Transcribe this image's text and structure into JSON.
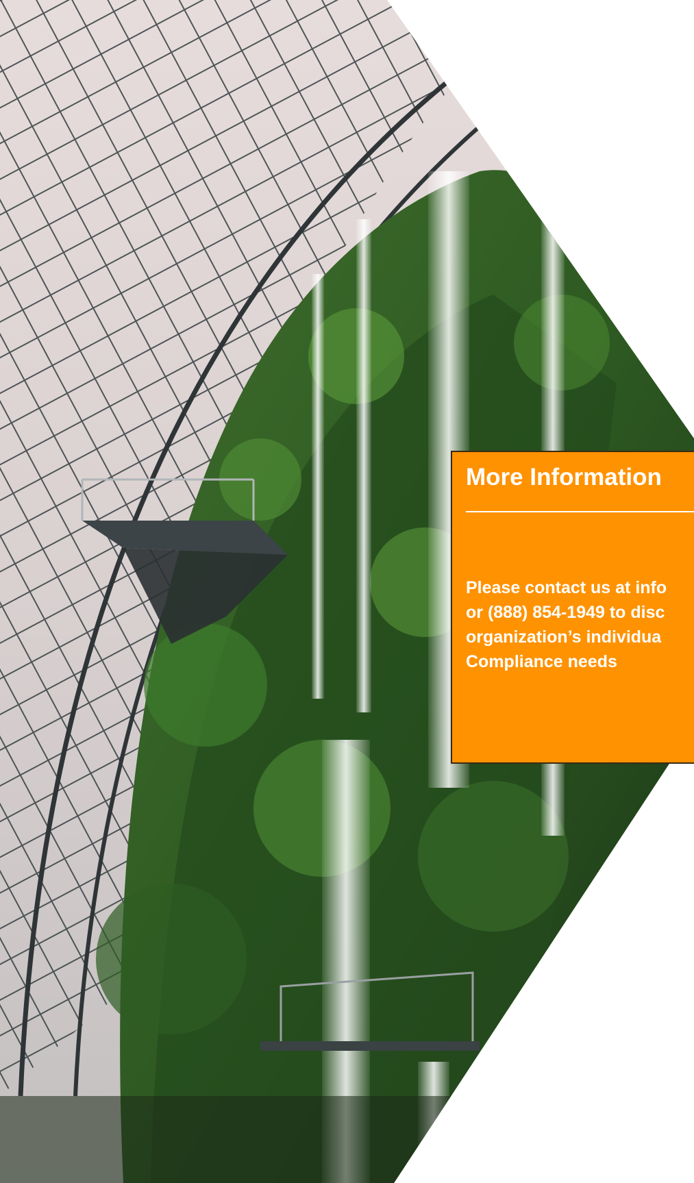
{
  "panel": {
    "title": "More Information",
    "body_lines": [
      "Please contact us at info",
      "or (888) 854-1949 to disc",
      "organization’s individua",
      "Compliance needs"
    ]
  },
  "colors": {
    "panel_background": "#ff9200",
    "panel_text": "#ffffff",
    "page_background": "#ffffff"
  },
  "photo": {
    "icon": "greenhouse-waterfall-photo"
  }
}
